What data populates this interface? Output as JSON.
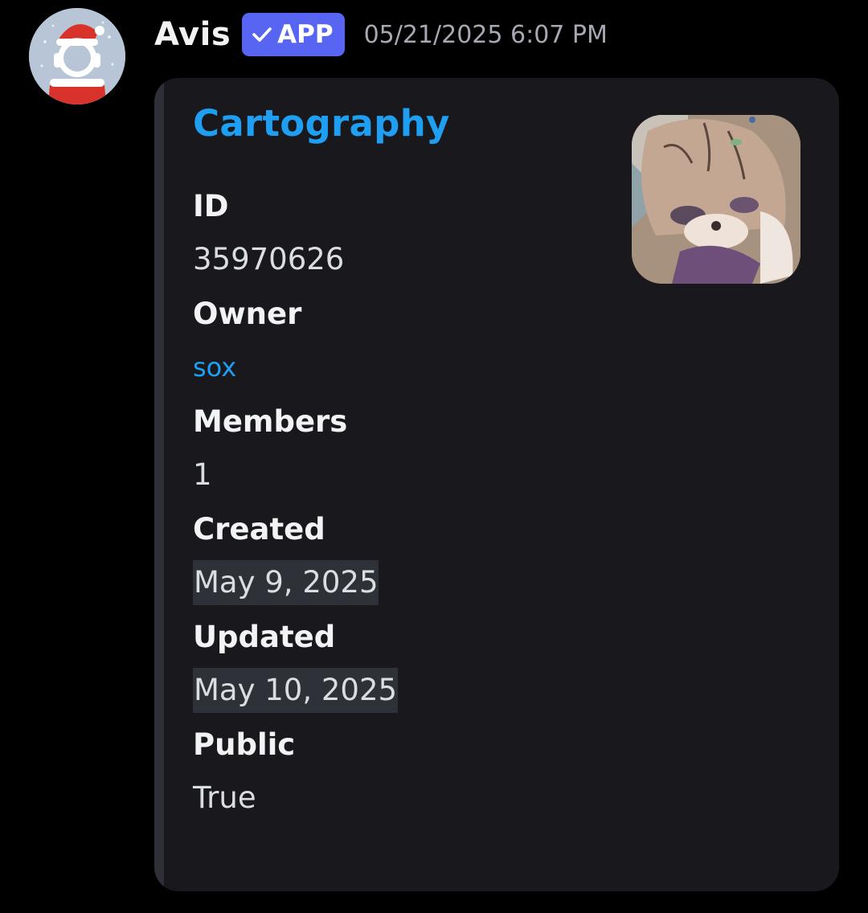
{
  "message": {
    "author": "Avis",
    "badge": "APP",
    "timestamp": "05/21/2025 6:07 PM"
  },
  "embed": {
    "title": "Cartography",
    "fields": [
      {
        "name": "ID",
        "value": "35970626"
      },
      {
        "name": "Owner",
        "value": "sox"
      },
      {
        "name": "Members",
        "value": "1"
      },
      {
        "name": "Created",
        "value": "May 9, 2025"
      },
      {
        "name": "Updated",
        "value": "May 10, 2025"
      },
      {
        "name": "Public",
        "value": "True"
      }
    ]
  },
  "colors": {
    "background": "#000000",
    "embed_bg": "#18181d",
    "link": "#1e9ff2",
    "badge": "#5865f2",
    "timestamp_text": "#a6a9b1"
  },
  "icons": {
    "badge_check": "check-icon",
    "avatar": "santa-hat-headphones-avatar",
    "thumbnail": "server-icon-image"
  }
}
